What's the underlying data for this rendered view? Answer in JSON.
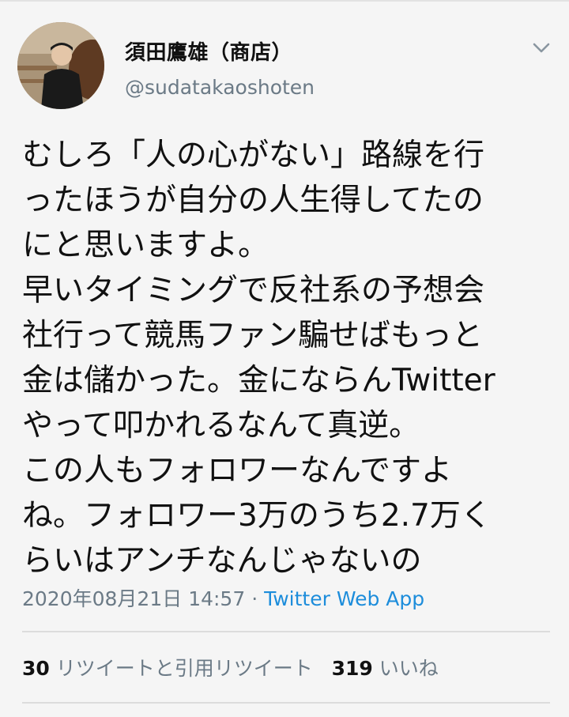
{
  "user": {
    "display_name": "須田鷹雄（商店）",
    "handle": "@sudatakaoshoten"
  },
  "tweet": {
    "lines": [
      "むしろ「人の心がない」路線を行",
      "ったほうが自分の人生得してたの",
      "にと思いますよ。",
      "早いタイミングで反社系の予想会",
      "社行って競馬ファン騙せばもっと",
      "金は儲かった。金にならんTwitter",
      "やって叩かれるなんて真逆。",
      "この人もフォロワーなんですよ",
      "ね。フォロワー3万のうち2.7万く",
      "らいはアンチなんじゃないの"
    ],
    "timestamp": "2020年08月21日 14:57",
    "separator": " · ",
    "source_app": "Twitter Web App"
  },
  "stats": {
    "retweets_count": "30",
    "retweets_label": "リツイートと引用リツイート",
    "likes_count": "319",
    "likes_label": "いいね"
  },
  "icons": {
    "menu": "chevron-down-icon",
    "avatar": "avatar"
  },
  "colors": {
    "background": "#f5f5f5",
    "secondary_text": "#6b7a86",
    "link": "#1d8ddb"
  }
}
